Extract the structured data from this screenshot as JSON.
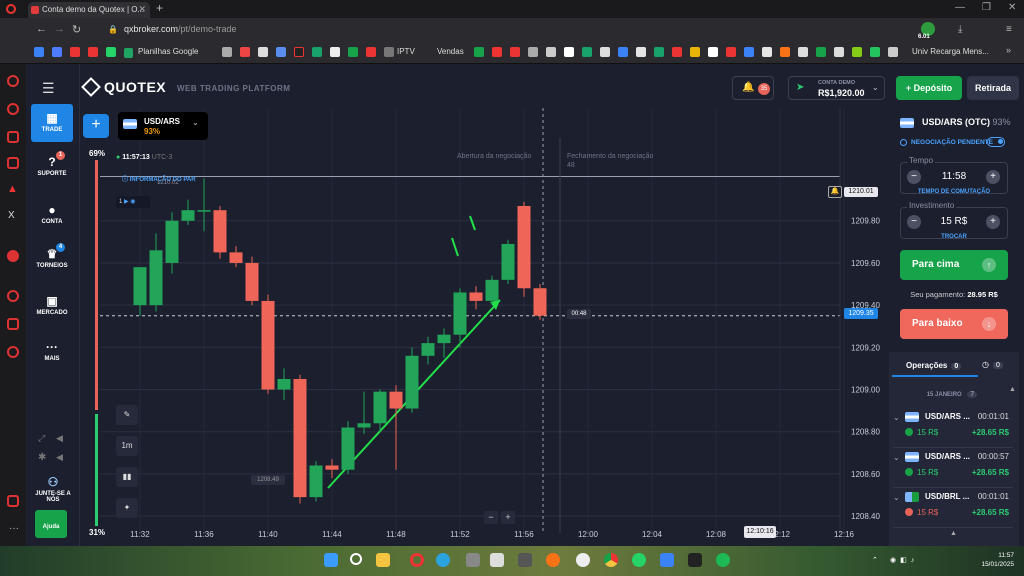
{
  "browser": {
    "tab_title": "Conta demo da Quotex | O...",
    "url_domain": "qxbroker.com",
    "url_path": "/pt/demo-trade",
    "bookmarks": [
      "Planilhas Google",
      "IPTV",
      "Vendas",
      "Univ Recarga Mens..."
    ],
    "badge_value": "6.01"
  },
  "header": {
    "logo": "QUOTEX",
    "subtitle": "WEB TRADING PLATFORM",
    "notif_count": "35",
    "account_label": "CONTA DEMO",
    "balance": "R$1,920.00",
    "deposit_label": "Depósito",
    "withdraw_label": "Retirada"
  },
  "nav": {
    "trade": "TRADE",
    "support": "SUPORTE",
    "support_badge": "1",
    "account": "CONTA",
    "tournaments": "TORNEIOS",
    "tournaments_badge": "4",
    "market": "MERCADO",
    "more": "MAIS",
    "join": "JUNTE-SE A NÓS",
    "help": "Ajuda"
  },
  "asset": {
    "name": "USD/ARS",
    "payout": "93%"
  },
  "chart_info": {
    "clock": "11:57:13",
    "timezone": "UTC-3",
    "info_label": "INFORMAÇÃO DO PAR",
    "info_price": "1210.02",
    "open_label": "Abertura da negociação",
    "close_label": "Fechamento da negociação",
    "close_sub": "48",
    "sentiment_up": "69%",
    "sentiment_down": "31%",
    "timeframe": "1m",
    "indicator_count": "1",
    "current_price": "1209.35",
    "countdown": "00:48",
    "alert_price": "1210.01",
    "low_label": "1208.49",
    "time_cursor": "12:10:16"
  },
  "chart_data": {
    "type": "candlestick",
    "y_ticks": [
      1209.8,
      1209.6,
      1209.4,
      1209.2,
      1209.0,
      1208.8,
      1208.6,
      1208.4
    ],
    "x_ticks": [
      "11:32",
      "11:36",
      "11:40",
      "11:44",
      "11:48",
      "11:52",
      "11:56",
      "12:00",
      "12:04",
      "12:08",
      "12:12",
      "12:16"
    ],
    "ylim": [
      1208.32,
      1210.05
    ],
    "candles": [
      {
        "t": "11:32",
        "o": 1209.4,
        "h": 1209.55,
        "l": 1209.35,
        "c": 1209.58
      },
      {
        "t": "11:33",
        "o": 1209.4,
        "h": 1209.74,
        "l": 1209.37,
        "c": 1209.66
      },
      {
        "t": "11:34",
        "o": 1209.6,
        "h": 1209.84,
        "l": 1209.55,
        "c": 1209.8
      },
      {
        "t": "11:35",
        "o": 1209.8,
        "h": 1209.9,
        "l": 1209.78,
        "c": 1209.85
      },
      {
        "t": "11:36",
        "o": 1209.85,
        "h": 1210.0,
        "l": 1209.75,
        "c": 1209.85
      },
      {
        "t": "11:37",
        "o": 1209.85,
        "h": 1209.87,
        "l": 1209.62,
        "c": 1209.65
      },
      {
        "t": "11:38",
        "o": 1209.65,
        "h": 1209.68,
        "l": 1209.58,
        "c": 1209.6
      },
      {
        "t": "11:39",
        "o": 1209.6,
        "h": 1209.63,
        "l": 1209.4,
        "c": 1209.42
      },
      {
        "t": "11:40",
        "o": 1209.42,
        "h": 1209.45,
        "l": 1208.98,
        "c": 1209.0
      },
      {
        "t": "11:41",
        "o": 1209.0,
        "h": 1209.1,
        "l": 1208.95,
        "c": 1209.05
      },
      {
        "t": "11:42",
        "o": 1209.05,
        "h": 1209.07,
        "l": 1208.46,
        "c": 1208.49
      },
      {
        "t": "11:43",
        "o": 1208.49,
        "h": 1208.66,
        "l": 1208.47,
        "c": 1208.64
      },
      {
        "t": "11:44",
        "o": 1208.64,
        "h": 1208.67,
        "l": 1208.58,
        "c": 1208.62
      },
      {
        "t": "11:45",
        "o": 1208.62,
        "h": 1208.85,
        "l": 1208.6,
        "c": 1208.82
      },
      {
        "t": "11:46",
        "o": 1208.82,
        "h": 1208.99,
        "l": 1208.79,
        "c": 1208.84
      },
      {
        "t": "11:47",
        "o": 1208.84,
        "h": 1209.0,
        "l": 1208.8,
        "c": 1208.99
      },
      {
        "t": "11:48",
        "o": 1208.99,
        "h": 1209.02,
        "l": 1208.62,
        "c": 1208.91
      },
      {
        "t": "11:49",
        "o": 1208.91,
        "h": 1209.2,
        "l": 1208.89,
        "c": 1209.16
      },
      {
        "t": "11:50",
        "o": 1209.16,
        "h": 1209.25,
        "l": 1209.12,
        "c": 1209.22
      },
      {
        "t": "11:51",
        "o": 1209.22,
        "h": 1209.29,
        "l": 1209.15,
        "c": 1209.26
      },
      {
        "t": "11:52",
        "o": 1209.26,
        "h": 1209.48,
        "l": 1209.2,
        "c": 1209.46
      },
      {
        "t": "11:53",
        "o": 1209.46,
        "h": 1209.49,
        "l": 1209.38,
        "c": 1209.42
      },
      {
        "t": "11:54",
        "o": 1209.42,
        "h": 1209.54,
        "l": 1209.4,
        "c": 1209.52
      },
      {
        "t": "11:55",
        "o": 1209.52,
        "h": 1209.71,
        "l": 1209.5,
        "c": 1209.69
      },
      {
        "t": "11:56",
        "o": 1209.87,
        "h": 1209.89,
        "l": 1209.44,
        "c": 1209.48
      },
      {
        "t": "11:57",
        "o": 1209.48,
        "h": 1209.5,
        "l": 1209.33,
        "c": 1209.35
      }
    ]
  },
  "trade_panel": {
    "asset": "USD/ARS (OTC)",
    "payout": "93%",
    "pending_label": "NEGOCIAÇÃO PENDENTE",
    "time_label": "Tempo",
    "time_value": "11:58",
    "time_sub": "TEMPO DE COMUTAÇÃO",
    "investment_label": "Investimento",
    "investment_value": "15 R$",
    "investment_sub": "TROCAR",
    "up_label": "Para cima",
    "down_label": "Para baixo",
    "payout_label": "Seu pagamento:",
    "payout_value": "28.95 R$"
  },
  "operations": {
    "tab_label": "Operações",
    "tab_count": "0",
    "second_count": "0",
    "date_label": "15 JANEIRO",
    "date_count": "7",
    "items": [
      {
        "asset": "USD/ARS ...",
        "time": "00:01:01",
        "amount": "15 R$",
        "profit": "+28.65 R$",
        "dir": "up"
      },
      {
        "asset": "USD/ARS ...",
        "time": "00:00:57",
        "amount": "15 R$",
        "profit": "+28.65 R$",
        "dir": "up"
      },
      {
        "asset": "USD/BRL ...",
        "time": "00:01:01",
        "amount": "15 R$",
        "profit": "+28.65 R$",
        "dir": "down"
      }
    ]
  },
  "taskbar": {
    "time": "11:57",
    "date": "15/01/2025"
  },
  "colors": {
    "up": "#16a34a",
    "down": "#f0675c",
    "accent": "#1f86e6"
  }
}
